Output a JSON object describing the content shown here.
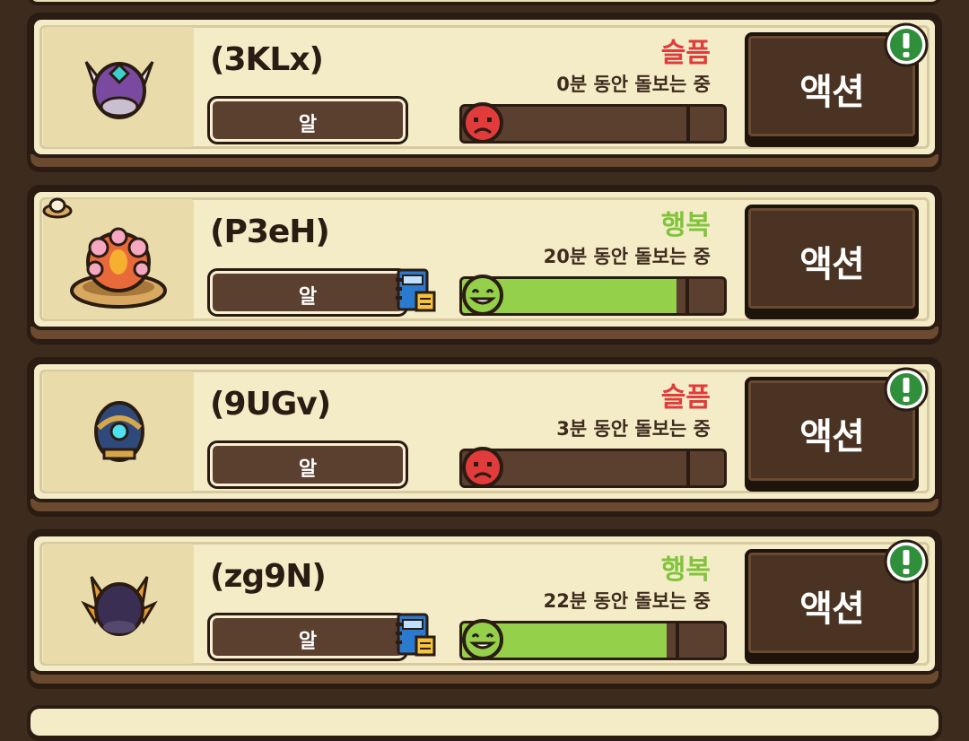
{
  "action_label": "액션",
  "pets": [
    {
      "name": "(3KLx)",
      "type": "알",
      "mood": "슬픔",
      "mood_kind": "sad",
      "care_time": "0분 동안 돌보는 중",
      "mood_fraction": 0.0,
      "has_book": false,
      "has_alert": true,
      "has_food": false,
      "pet_icon": "purple-horned-egg-icon"
    },
    {
      "name": "(P3eH)",
      "type": "알",
      "mood": "행복",
      "mood_kind": "happy",
      "care_time": "20분 동안 돌보는 중",
      "mood_fraction": 0.82,
      "has_book": true,
      "has_alert": false,
      "has_food": true,
      "pet_icon": "pink-flower-egg-in-nest-icon"
    },
    {
      "name": "(9UGv)",
      "type": "알",
      "mood": "슬픔",
      "mood_kind": "sad",
      "care_time": "3분 동안 돌보는 중",
      "mood_fraction": 0.0,
      "has_book": false,
      "has_alert": true,
      "has_food": false,
      "pet_icon": "blue-gem-egg-icon"
    },
    {
      "name": "(zg9N)",
      "type": "알",
      "mood": "행복",
      "mood_kind": "happy",
      "care_time": "22분 동안 돌보는 중",
      "mood_fraction": 0.78,
      "has_book": true,
      "has_alert": true,
      "has_food": false,
      "pet_icon": "dark-flame-horned-egg-icon"
    }
  ],
  "colors": {
    "sad": "#e23b3b",
    "happy": "#7fc43a",
    "bar_fill": "#94d04a",
    "alert": "#2f8f3a"
  }
}
